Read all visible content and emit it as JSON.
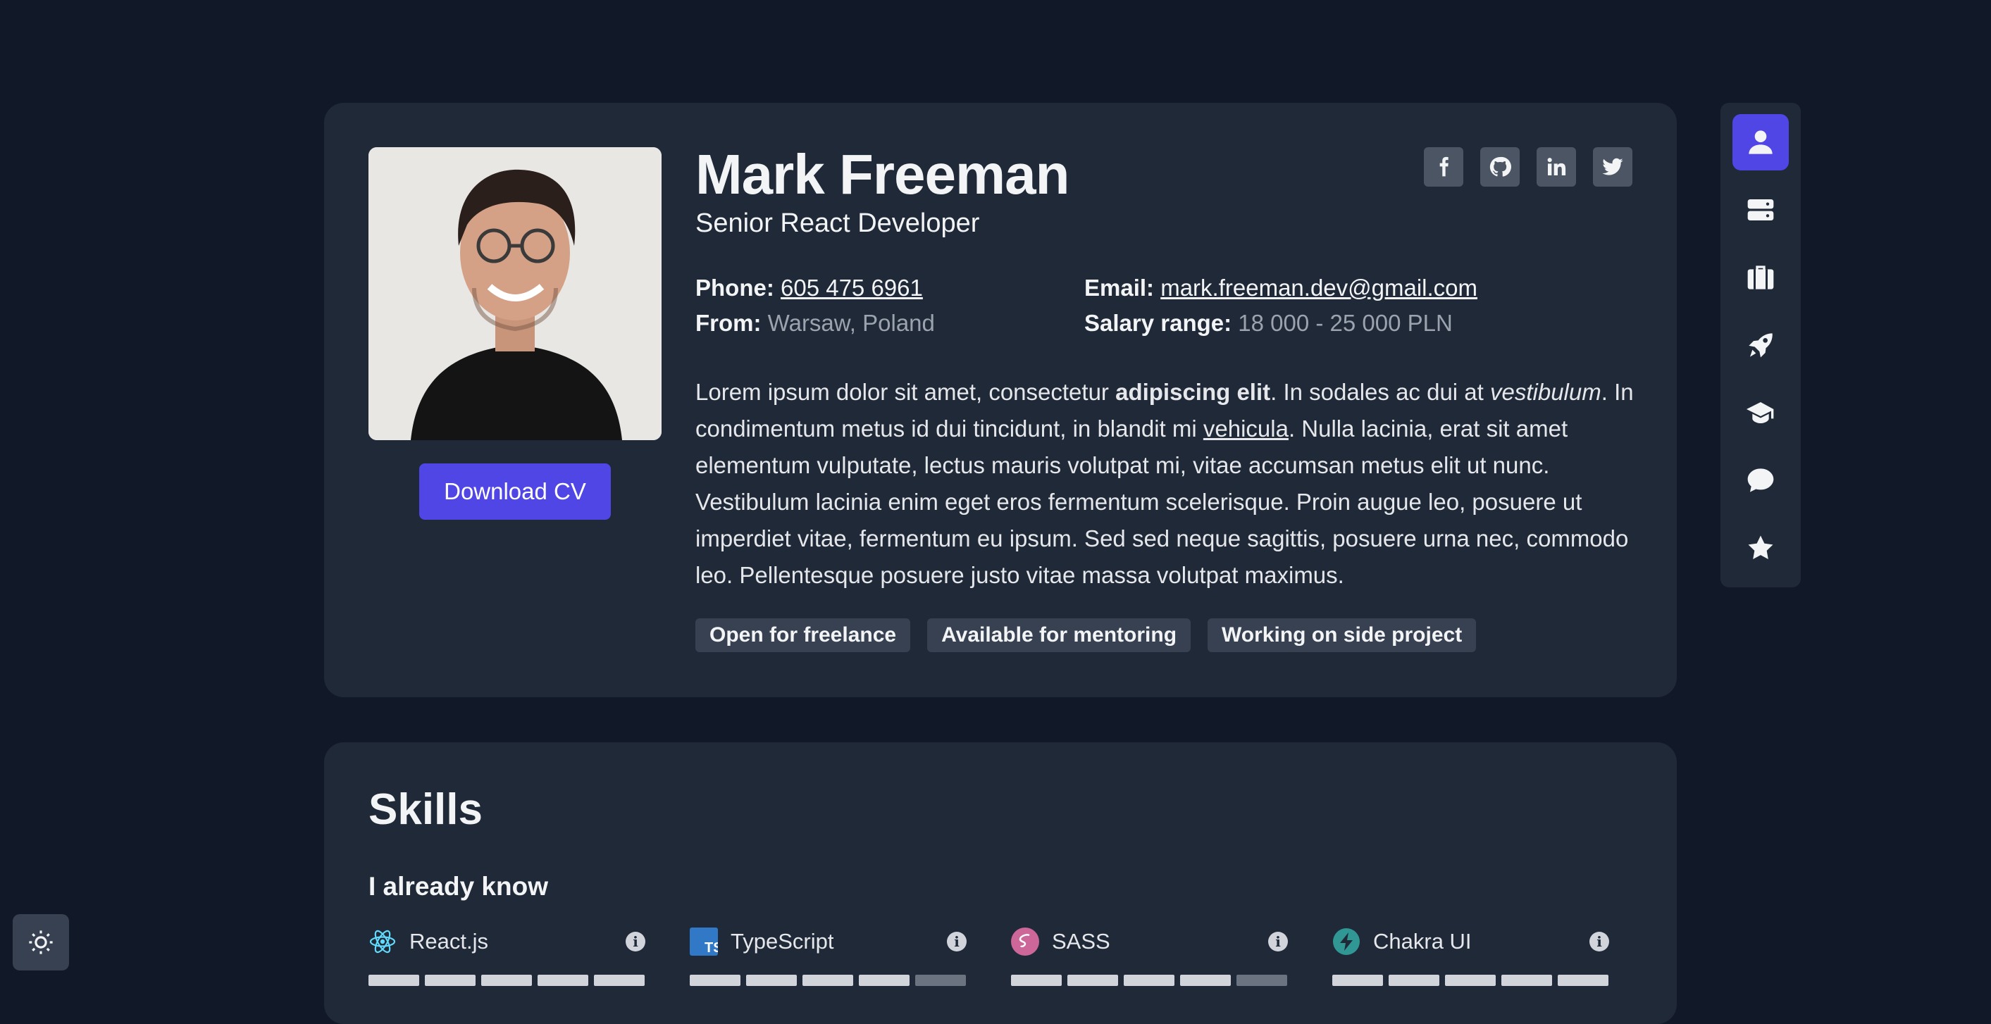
{
  "profile": {
    "name": "Mark Freeman",
    "role": "Senior React Developer",
    "download_label": "Download CV",
    "phone_label": "Phone:",
    "phone": "605 475 6961",
    "from_label": "From:",
    "from": "Warsaw, Poland",
    "email_label": "Email:",
    "email": "mark.freeman.dev@gmail.com",
    "salary_label": "Salary range:",
    "salary": "18 000 - 25 000 PLN",
    "bio": {
      "p1": "Lorem ipsum dolor sit amet, consectetur ",
      "b1": "adipiscing elit",
      "p2": ". In sodales ac dui at ",
      "i1": "vestibulum",
      "p3": ". In condimentum metus id dui tincidunt, in blandit mi ",
      "link": "vehicula",
      "p4": ". Nulla lacinia, erat sit amet elementum vulputate, lectus mauris volutpat mi, vitae accumsan metus elit ut nunc. Vestibulum lacinia enim eget eros fermentum scelerisque. Proin augue leo, posuere ut imperdiet vitae, fermentum eu ipsum. Sed sed neque sagittis, posuere urna nec, commodo leo. Pellentesque posuere justo vitae massa volutpat maximus."
    },
    "tags": [
      "Open for freelance",
      "Available for mentoring",
      "Working on side project"
    ],
    "socials": [
      "facebook-icon",
      "github-icon",
      "linkedin-icon",
      "twitter-icon"
    ]
  },
  "sidenav": {
    "items": [
      "user-icon",
      "server-icon",
      "briefcase-icon",
      "rocket-icon",
      "graduation-cap-icon",
      "comment-icon",
      "star-icon"
    ],
    "active": "user-icon"
  },
  "skills": {
    "title": "Skills",
    "subtitle": "I already know",
    "items": [
      {
        "name": "React.js",
        "icon": "react-icon",
        "level": 5,
        "max": 5
      },
      {
        "name": "TypeScript",
        "icon": "typescript-icon",
        "level": 4,
        "max": 5
      },
      {
        "name": "SASS",
        "icon": "sass-icon",
        "level": 4,
        "max": 5
      },
      {
        "name": "Chakra UI",
        "icon": "chakra-icon",
        "level": 5,
        "max": 5
      }
    ]
  },
  "colors": {
    "background": "#111827",
    "card": "#1f2937",
    "accent": "#4f46e5",
    "tag": "#374151"
  }
}
